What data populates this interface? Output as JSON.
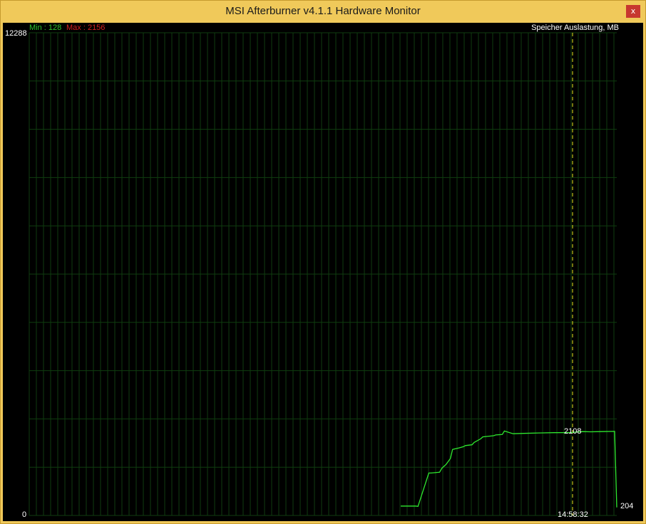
{
  "window": {
    "title": "MSI Afterburner v4.1.1 Hardware Monitor",
    "close_label": "x",
    "close_icon": "close-icon"
  },
  "graph": {
    "name": "Speicher Auslastung, MB",
    "min_label": "Min : 128",
    "max_label": "Max : 2156",
    "y_top_label": "12288",
    "y_bottom_label": "0",
    "cursor_value_label": "2108",
    "cursor_time_label": "14:58:32",
    "current_value_label": "204",
    "colors": {
      "background": "#000000",
      "grid": "#0f3d0f",
      "line": "#2ee82e",
      "cursor": "#e6e61c",
      "min_text": "#2ec42e",
      "max_text": "#d42020",
      "label_text": "#ffffff"
    }
  },
  "chart_data": {
    "type": "line",
    "title": "Speicher Auslastung, MB",
    "ylim": [
      0,
      12288
    ],
    "min": 128,
    "max": 2156,
    "cursor_time": "14:58:32",
    "cursor_value": 2108,
    "current_value": 204,
    "grid": true,
    "series": [
      {
        "name": "Speicher Auslastung, MB",
        "x": [
          0,
          7,
          8,
          13,
          14,
          18,
          19,
          20,
          21,
          23,
          24,
          27,
          29,
          30,
          33,
          34,
          37,
          38,
          43,
          44,
          47,
          48,
          52,
          57,
          64,
          71,
          79,
          80,
          83,
          84,
          88,
          93,
          99,
          100
        ],
        "values": [
          240,
          240,
          230,
          1080,
          1080,
          1100,
          1200,
          1250,
          1300,
          1450,
          1680,
          1720,
          1750,
          1780,
          1800,
          1860,
          1950,
          2000,
          2030,
          2050,
          2060,
          2150,
          2080,
          2090,
          2100,
          2108,
          2110,
          2120,
          2130,
          2135,
          2130,
          2135,
          2140,
          204
        ]
      }
    ]
  }
}
